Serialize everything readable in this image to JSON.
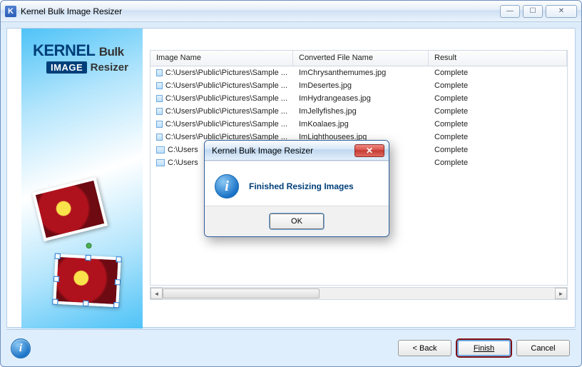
{
  "window": {
    "title": "Kernel Bulk Image Resizer",
    "icon_letter": "K"
  },
  "brand": {
    "name": "KERNEL",
    "suffix": "Bulk",
    "badge": "IMAGE",
    "tail": "Resizer"
  },
  "columns": {
    "c1": "Image Name",
    "c2": "Converted File Name",
    "c3": "Result"
  },
  "rows": [
    {
      "img": "C:\\Users\\Public\\Pictures\\Sample ...",
      "conv": "ImChrysanthemumes.jpg",
      "res": "Complete"
    },
    {
      "img": "C:\\Users\\Public\\Pictures\\Sample ...",
      "conv": "ImDesertes.jpg",
      "res": "Complete"
    },
    {
      "img": "C:\\Users\\Public\\Pictures\\Sample ...",
      "conv": "ImHydrangeases.jpg",
      "res": "Complete"
    },
    {
      "img": "C:\\Users\\Public\\Pictures\\Sample ...",
      "conv": "ImJellyfishes.jpg",
      "res": "Complete"
    },
    {
      "img": "C:\\Users\\Public\\Pictures\\Sample ...",
      "conv": "ImKoalaes.jpg",
      "res": "Complete"
    },
    {
      "img": "C:\\Users\\Public\\Pictures\\Sample ...",
      "conv": "ImLighthousees.jpg",
      "res": "Complete"
    },
    {
      "img": "C:\\Users",
      "conv": "",
      "res": "Complete"
    },
    {
      "img": "C:\\Users",
      "conv": "",
      "res": "Complete"
    }
  ],
  "footer": {
    "back": "< Back",
    "finish": "Finish",
    "cancel": "Cancel",
    "info": "i"
  },
  "modal": {
    "title": "Kernel Bulk Image Resizer",
    "message": "Finished Resizing Images",
    "ok": "OK",
    "icon": "i"
  }
}
